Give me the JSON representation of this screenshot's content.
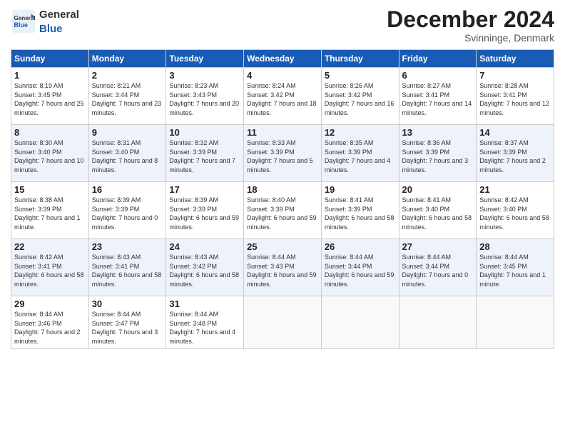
{
  "header": {
    "logo_general": "General",
    "logo_blue": "Blue",
    "title": "December 2024",
    "location": "Svinninge, Denmark"
  },
  "weekdays": [
    "Sunday",
    "Monday",
    "Tuesday",
    "Wednesday",
    "Thursday",
    "Friday",
    "Saturday"
  ],
  "weeks": [
    [
      {
        "day": "1",
        "sunrise": "Sunrise: 8:19 AM",
        "sunset": "Sunset: 3:45 PM",
        "daylight": "Daylight: 7 hours and 25 minutes."
      },
      {
        "day": "2",
        "sunrise": "Sunrise: 8:21 AM",
        "sunset": "Sunset: 3:44 PM",
        "daylight": "Daylight: 7 hours and 23 minutes."
      },
      {
        "day": "3",
        "sunrise": "Sunrise: 8:23 AM",
        "sunset": "Sunset: 3:43 PM",
        "daylight": "Daylight: 7 hours and 20 minutes."
      },
      {
        "day": "4",
        "sunrise": "Sunrise: 8:24 AM",
        "sunset": "Sunset: 3:42 PM",
        "daylight": "Daylight: 7 hours and 18 minutes."
      },
      {
        "day": "5",
        "sunrise": "Sunrise: 8:26 AM",
        "sunset": "Sunset: 3:42 PM",
        "daylight": "Daylight: 7 hours and 16 minutes."
      },
      {
        "day": "6",
        "sunrise": "Sunrise: 8:27 AM",
        "sunset": "Sunset: 3:41 PM",
        "daylight": "Daylight: 7 hours and 14 minutes."
      },
      {
        "day": "7",
        "sunrise": "Sunrise: 8:28 AM",
        "sunset": "Sunset: 3:41 PM",
        "daylight": "Daylight: 7 hours and 12 minutes."
      }
    ],
    [
      {
        "day": "8",
        "sunrise": "Sunrise: 8:30 AM",
        "sunset": "Sunset: 3:40 PM",
        "daylight": "Daylight: 7 hours and 10 minutes."
      },
      {
        "day": "9",
        "sunrise": "Sunrise: 8:31 AM",
        "sunset": "Sunset: 3:40 PM",
        "daylight": "Daylight: 7 hours and 8 minutes."
      },
      {
        "day": "10",
        "sunrise": "Sunrise: 8:32 AM",
        "sunset": "Sunset: 3:39 PM",
        "daylight": "Daylight: 7 hours and 7 minutes."
      },
      {
        "day": "11",
        "sunrise": "Sunrise: 8:33 AM",
        "sunset": "Sunset: 3:39 PM",
        "daylight": "Daylight: 7 hours and 5 minutes."
      },
      {
        "day": "12",
        "sunrise": "Sunrise: 8:35 AM",
        "sunset": "Sunset: 3:39 PM",
        "daylight": "Daylight: 7 hours and 4 minutes."
      },
      {
        "day": "13",
        "sunrise": "Sunrise: 8:36 AM",
        "sunset": "Sunset: 3:39 PM",
        "daylight": "Daylight: 7 hours and 3 minutes."
      },
      {
        "day": "14",
        "sunrise": "Sunrise: 8:37 AM",
        "sunset": "Sunset: 3:39 PM",
        "daylight": "Daylight: 7 hours and 2 minutes."
      }
    ],
    [
      {
        "day": "15",
        "sunrise": "Sunrise: 8:38 AM",
        "sunset": "Sunset: 3:39 PM",
        "daylight": "Daylight: 7 hours and 1 minute."
      },
      {
        "day": "16",
        "sunrise": "Sunrise: 8:39 AM",
        "sunset": "Sunset: 3:39 PM",
        "daylight": "Daylight: 7 hours and 0 minutes."
      },
      {
        "day": "17",
        "sunrise": "Sunrise: 8:39 AM",
        "sunset": "Sunset: 3:39 PM",
        "daylight": "Daylight: 6 hours and 59 minutes."
      },
      {
        "day": "18",
        "sunrise": "Sunrise: 8:40 AM",
        "sunset": "Sunset: 3:39 PM",
        "daylight": "Daylight: 6 hours and 59 minutes."
      },
      {
        "day": "19",
        "sunrise": "Sunrise: 8:41 AM",
        "sunset": "Sunset: 3:39 PM",
        "daylight": "Daylight: 6 hours and 58 minutes."
      },
      {
        "day": "20",
        "sunrise": "Sunrise: 8:41 AM",
        "sunset": "Sunset: 3:40 PM",
        "daylight": "Daylight: 6 hours and 58 minutes."
      },
      {
        "day": "21",
        "sunrise": "Sunrise: 8:42 AM",
        "sunset": "Sunset: 3:40 PM",
        "daylight": "Daylight: 6 hours and 58 minutes."
      }
    ],
    [
      {
        "day": "22",
        "sunrise": "Sunrise: 8:42 AM",
        "sunset": "Sunset: 3:41 PM",
        "daylight": "Daylight: 6 hours and 58 minutes."
      },
      {
        "day": "23",
        "sunrise": "Sunrise: 8:43 AM",
        "sunset": "Sunset: 3:41 PM",
        "daylight": "Daylight: 6 hours and 58 minutes."
      },
      {
        "day": "24",
        "sunrise": "Sunrise: 8:43 AM",
        "sunset": "Sunset: 3:42 PM",
        "daylight": "Daylight: 6 hours and 58 minutes."
      },
      {
        "day": "25",
        "sunrise": "Sunrise: 8:44 AM",
        "sunset": "Sunset: 3:43 PM",
        "daylight": "Daylight: 6 hours and 59 minutes."
      },
      {
        "day": "26",
        "sunrise": "Sunrise: 8:44 AM",
        "sunset": "Sunset: 3:44 PM",
        "daylight": "Daylight: 6 hours and 59 minutes."
      },
      {
        "day": "27",
        "sunrise": "Sunrise: 8:44 AM",
        "sunset": "Sunset: 3:44 PM",
        "daylight": "Daylight: 7 hours and 0 minutes."
      },
      {
        "day": "28",
        "sunrise": "Sunrise: 8:44 AM",
        "sunset": "Sunset: 3:45 PM",
        "daylight": "Daylight: 7 hours and 1 minute."
      }
    ],
    [
      {
        "day": "29",
        "sunrise": "Sunrise: 8:44 AM",
        "sunset": "Sunset: 3:46 PM",
        "daylight": "Daylight: 7 hours and 2 minutes."
      },
      {
        "day": "30",
        "sunrise": "Sunrise: 8:44 AM",
        "sunset": "Sunset: 3:47 PM",
        "daylight": "Daylight: 7 hours and 3 minutes."
      },
      {
        "day": "31",
        "sunrise": "Sunrise: 8:44 AM",
        "sunset": "Sunset: 3:48 PM",
        "daylight": "Daylight: 7 hours and 4 minutes."
      },
      null,
      null,
      null,
      null
    ]
  ]
}
